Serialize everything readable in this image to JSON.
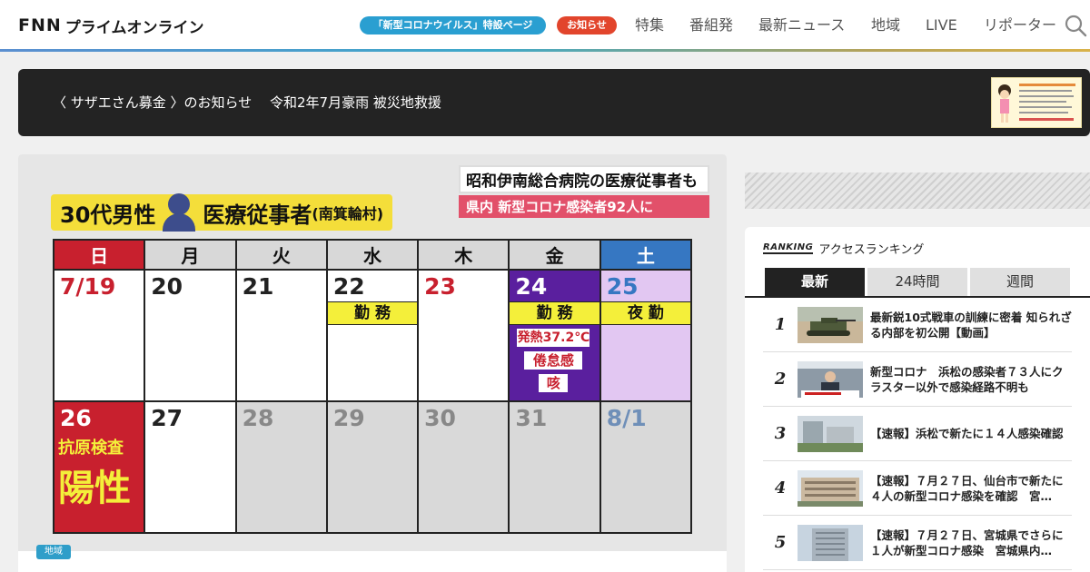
{
  "header": {
    "logo_fnn": "FNN",
    "logo_sub": "プライムオンライン",
    "pill_corona": "「新型コロナウイルス」特設ページ",
    "pill_notice": "お知らせ",
    "nav": [
      "特集",
      "番組発",
      "最新ニュース",
      "地域",
      "LIVE",
      "リポーター"
    ]
  },
  "banner": {
    "text": "〈 サザエさん募金 〉のお知らせ　 令和2年7月豪雨 被災地救援"
  },
  "article": {
    "region_tag": "地域",
    "graphic": {
      "title_left": "30代男性",
      "title_right": "医療従事者",
      "title_sub": "(南箕輪村)",
      "note_line1": "昭和伊南総合病院の医療従事者も",
      "note_line2": "県内 新型コロナ感染者92人に",
      "weekdays": [
        "日",
        "月",
        "火",
        "水",
        "木",
        "金",
        "土"
      ],
      "week1": [
        "7/19",
        "20",
        "21",
        "22",
        "23",
        "24",
        "25"
      ],
      "week2": [
        "26",
        "27",
        "28",
        "29",
        "30",
        "31",
        "8/1"
      ],
      "shift_label": "勤 務",
      "night_label": "夜 勤",
      "symptom_fever": "発熱37.2℃",
      "symptom_fatigue": "倦怠感",
      "symptom_cough": "咳",
      "test_label": "抗原検査",
      "result_label": "陽性"
    }
  },
  "ranking": {
    "label_en": "RANKING",
    "label_jp": "アクセスランキング",
    "tabs": [
      "最新",
      "24時間",
      "週間"
    ],
    "items": [
      {
        "rank": "1",
        "title": "最新鋭10式戦車の訓練に密着 知られざる内部を初公開【動画】"
      },
      {
        "rank": "2",
        "title": "新型コロナ　浜松の感染者７３人にクラスター以外で感染経路不明も"
      },
      {
        "rank": "3",
        "title": "【速報】浜松で新たに１４人感染確認"
      },
      {
        "rank": "4",
        "title": "【速報】７月２７日、仙台市で新たに４人の新型コロナ感染を確認　宮…"
      },
      {
        "rank": "5",
        "title": "【速報】７月２７日、宮城県でさらに１人が新型コロナ感染　宮城県内…"
      }
    ]
  },
  "colors": {
    "accent_blue": "#2a9fd1",
    "notice_red": "#e2452c",
    "calendar_yellow": "#f4ef3a",
    "sunday_red": "#c8202e",
    "saturday_blue": "#3677c2"
  }
}
